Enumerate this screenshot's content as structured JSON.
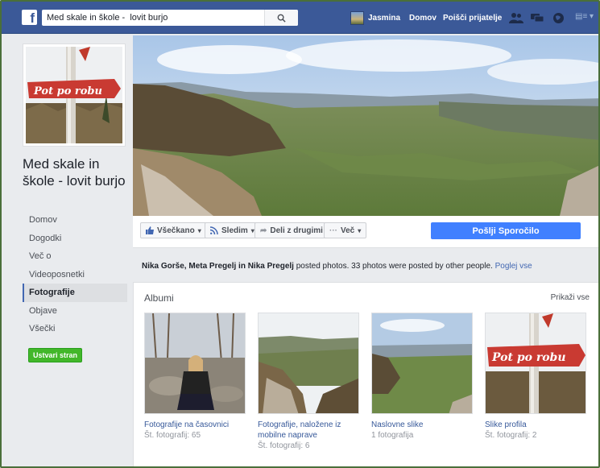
{
  "topbar": {
    "search_value": "Med skale in škole -  lovit burjo",
    "user_name": "Jasmina",
    "home_label": "Domov",
    "find_friends_label": "Poišči prijatelje",
    "brand_color": "#3b5998"
  },
  "page": {
    "title": "Med skale in škole - lovit burjo",
    "profile_sign_text": "Pot po robu"
  },
  "sidebar": {
    "items": [
      {
        "label": "Domov"
      },
      {
        "label": "Dogodki"
      },
      {
        "label": "Več o"
      },
      {
        "label": "Videoposnetki"
      },
      {
        "label": "Fotografije"
      },
      {
        "label": "Objave"
      },
      {
        "label": "Všečki"
      }
    ],
    "active_index": 4,
    "create_page_label": "Ustvari stran"
  },
  "actions": {
    "liked_label": "Všečkano",
    "follow_label": "Sledim",
    "share_label": "Deli z drugimi",
    "more_label": "Več",
    "message_label": "Pošlji Sporočilo"
  },
  "posted": {
    "names": "Nika Gorše, Meta Pregelj in Nika Pregelj",
    "text": " posted photos. 33 photos were posted by other people. ",
    "link": "Poglej vse"
  },
  "albums": {
    "title": "Albumi",
    "show_all": "Prikaži vse",
    "items": [
      {
        "name": "Fotografije na časovnici",
        "count": "Št. fotografij: 65"
      },
      {
        "name": "Fotografije, naložene iz mobilne naprave",
        "count": "Št. fotografij: 6"
      },
      {
        "name": "Naslovne slike",
        "count": "1 fotografija"
      },
      {
        "name": "Slike profila",
        "count": "Št. fotografij: 2"
      }
    ]
  }
}
